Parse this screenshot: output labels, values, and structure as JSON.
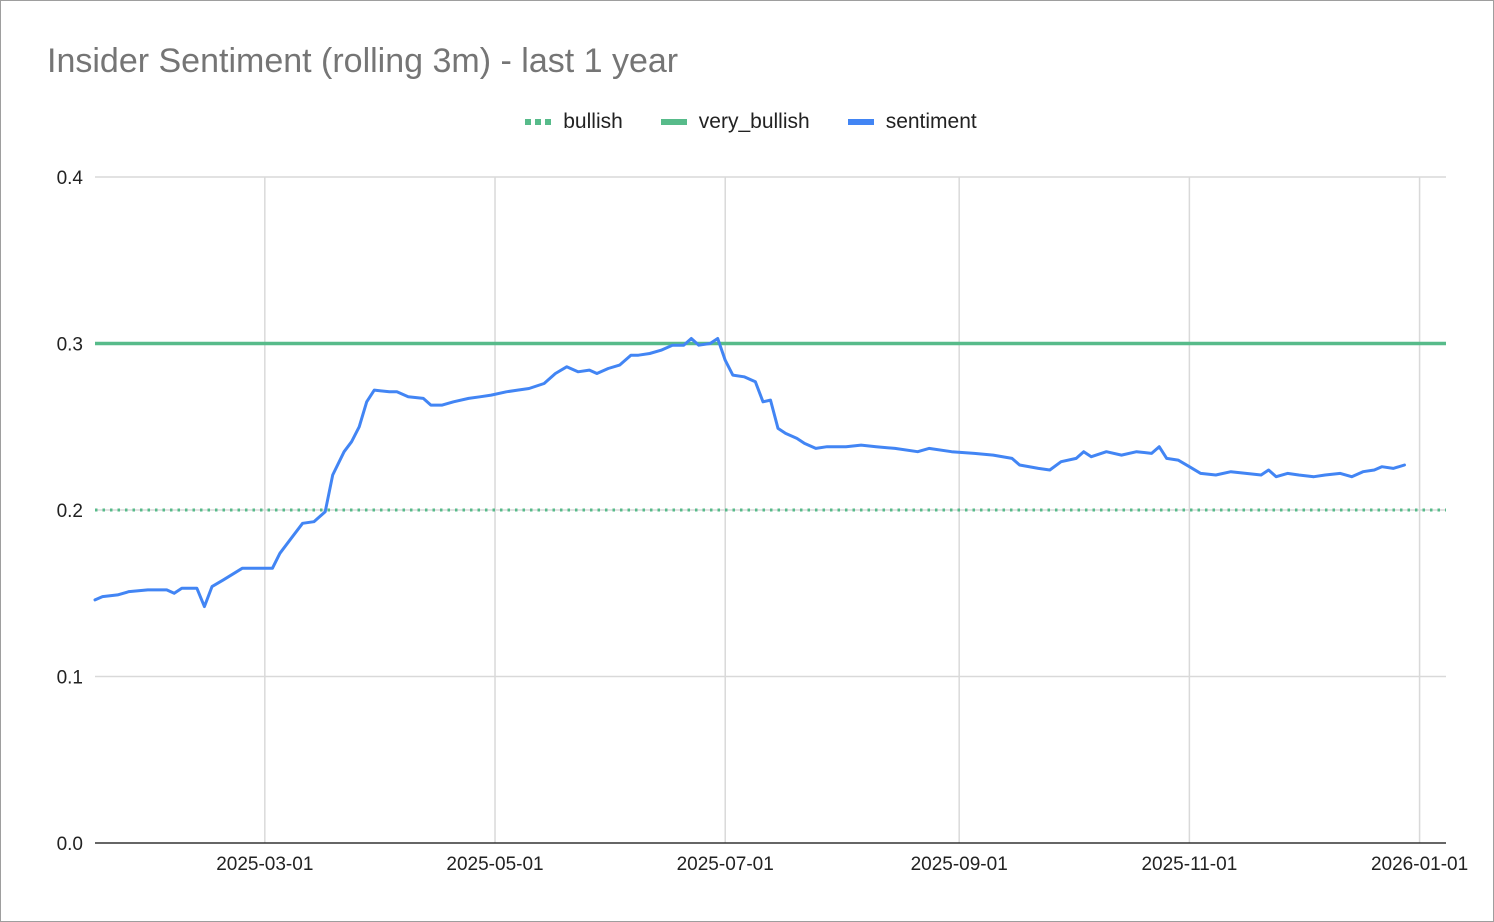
{
  "chart_data": {
    "type": "line",
    "title": "Insider Sentiment (rolling 3m) - last 1 year",
    "xlabel": "",
    "ylabel": "",
    "ylim": [
      0,
      0.4
    ],
    "yticks": [
      "0.0",
      "0.1",
      "0.2",
      "0.3",
      "0.4"
    ],
    "xlim": [
      "2025-01-15",
      "2026-01-08"
    ],
    "xticks": [
      {
        "date": "2025-03-01",
        "label": "2025-03-01"
      },
      {
        "date": "2025-05-01",
        "label": "2025-05-01"
      },
      {
        "date": "2025-07-01",
        "label": "2025-07-01"
      },
      {
        "date": "2025-09-01",
        "label": "2025-09-01"
      },
      {
        "date": "2025-11-01",
        "label": "2025-11-01"
      },
      {
        "date": "2026-01-01",
        "label": "2026-01-01"
      }
    ],
    "grid": true,
    "legend_position": "top",
    "series": [
      {
        "name": "bullish",
        "style": "dotted",
        "color": "#57bb8a",
        "value": 0.2
      },
      {
        "name": "very_bullish",
        "style": "solid",
        "color": "#57bb8a",
        "value": 0.3
      },
      {
        "name": "sentiment",
        "style": "solid",
        "color": "#4285f4",
        "points": [
          [
            "2025-01-15",
            0.146
          ],
          [
            "2025-01-17",
            0.148
          ],
          [
            "2025-01-21",
            0.149
          ],
          [
            "2025-01-24",
            0.151
          ],
          [
            "2025-01-29",
            0.152
          ],
          [
            "2025-02-03",
            0.152
          ],
          [
            "2025-02-05",
            0.15
          ],
          [
            "2025-02-07",
            0.153
          ],
          [
            "2025-02-11",
            0.153
          ],
          [
            "2025-02-13",
            0.142
          ],
          [
            "2025-02-15",
            0.154
          ],
          [
            "2025-02-18",
            0.158
          ],
          [
            "2025-02-23",
            0.165
          ],
          [
            "2025-02-26",
            0.165
          ],
          [
            "2025-03-03",
            0.165
          ],
          [
            "2025-03-05",
            0.174
          ],
          [
            "2025-03-08",
            0.183
          ],
          [
            "2025-03-11",
            0.192
          ],
          [
            "2025-03-14",
            0.193
          ],
          [
            "2025-03-17",
            0.199
          ],
          [
            "2025-03-19",
            0.221
          ],
          [
            "2025-03-22",
            0.235
          ],
          [
            "2025-03-24",
            0.241
          ],
          [
            "2025-03-26",
            0.25
          ],
          [
            "2025-03-28",
            0.265
          ],
          [
            "2025-03-30",
            0.272
          ],
          [
            "2025-04-03",
            0.271
          ],
          [
            "2025-04-05",
            0.271
          ],
          [
            "2025-04-08",
            0.268
          ],
          [
            "2025-04-12",
            0.267
          ],
          [
            "2025-04-14",
            0.263
          ],
          [
            "2025-04-17",
            0.263
          ],
          [
            "2025-04-20",
            0.265
          ],
          [
            "2025-04-24",
            0.267
          ],
          [
            "2025-04-27",
            0.268
          ],
          [
            "2025-04-30",
            0.269
          ],
          [
            "2025-05-04",
            0.271
          ],
          [
            "2025-05-07",
            0.272
          ],
          [
            "2025-05-10",
            0.273
          ],
          [
            "2025-05-14",
            0.276
          ],
          [
            "2025-05-17",
            0.282
          ],
          [
            "2025-05-20",
            0.286
          ],
          [
            "2025-05-23",
            0.283
          ],
          [
            "2025-05-26",
            0.284
          ],
          [
            "2025-05-28",
            0.282
          ],
          [
            "2025-05-31",
            0.285
          ],
          [
            "2025-06-03",
            0.287
          ],
          [
            "2025-06-06",
            0.293
          ],
          [
            "2025-06-08",
            0.293
          ],
          [
            "2025-06-11",
            0.294
          ],
          [
            "2025-06-14",
            0.296
          ],
          [
            "2025-06-17",
            0.299
          ],
          [
            "2025-06-20",
            0.299
          ],
          [
            "2025-06-22",
            0.303
          ],
          [
            "2025-06-24",
            0.299
          ],
          [
            "2025-06-27",
            0.3
          ],
          [
            "2025-06-29",
            0.303
          ],
          [
            "2025-07-01",
            0.29
          ],
          [
            "2025-07-03",
            0.281
          ],
          [
            "2025-07-06",
            0.28
          ],
          [
            "2025-07-09",
            0.277
          ],
          [
            "2025-07-11",
            0.265
          ],
          [
            "2025-07-13",
            0.266
          ],
          [
            "2025-07-15",
            0.249
          ],
          [
            "2025-07-17",
            0.246
          ],
          [
            "2025-07-20",
            0.243
          ],
          [
            "2025-07-22",
            0.24
          ],
          [
            "2025-07-25",
            0.237
          ],
          [
            "2025-07-28",
            0.238
          ],
          [
            "2025-08-02",
            0.238
          ],
          [
            "2025-08-06",
            0.239
          ],
          [
            "2025-08-10",
            0.238
          ],
          [
            "2025-08-15",
            0.237
          ],
          [
            "2025-08-21",
            0.235
          ],
          [
            "2025-08-24",
            0.237
          ],
          [
            "2025-08-30",
            0.235
          ],
          [
            "2025-09-05",
            0.234
          ],
          [
            "2025-09-10",
            0.233
          ],
          [
            "2025-09-15",
            0.231
          ],
          [
            "2025-09-17",
            0.227
          ],
          [
            "2025-09-22",
            0.225
          ],
          [
            "2025-09-25",
            0.224
          ],
          [
            "2025-09-28",
            0.229
          ],
          [
            "2025-10-02",
            0.231
          ],
          [
            "2025-10-04",
            0.235
          ],
          [
            "2025-10-06",
            0.232
          ],
          [
            "2025-10-10",
            0.235
          ],
          [
            "2025-10-14",
            0.233
          ],
          [
            "2025-10-18",
            0.235
          ],
          [
            "2025-10-22",
            0.234
          ],
          [
            "2025-10-24",
            0.238
          ],
          [
            "2025-10-26",
            0.231
          ],
          [
            "2025-10-29",
            0.23
          ],
          [
            "2025-11-01",
            0.226
          ],
          [
            "2025-11-04",
            0.222
          ],
          [
            "2025-11-08",
            0.221
          ],
          [
            "2025-11-12",
            0.223
          ],
          [
            "2025-11-16",
            0.222
          ],
          [
            "2025-11-20",
            0.221
          ],
          [
            "2025-11-22",
            0.224
          ],
          [
            "2025-11-24",
            0.22
          ],
          [
            "2025-11-27",
            0.222
          ],
          [
            "2025-11-30",
            0.221
          ],
          [
            "2025-12-04",
            0.22
          ],
          [
            "2025-12-07",
            0.221
          ],
          [
            "2025-12-11",
            0.222
          ],
          [
            "2025-12-14",
            0.22
          ],
          [
            "2025-12-17",
            0.223
          ],
          [
            "2025-12-20",
            0.224
          ],
          [
            "2025-12-22",
            0.226
          ],
          [
            "2025-12-25",
            0.225
          ],
          [
            "2025-12-28",
            0.227
          ]
        ]
      }
    ]
  }
}
